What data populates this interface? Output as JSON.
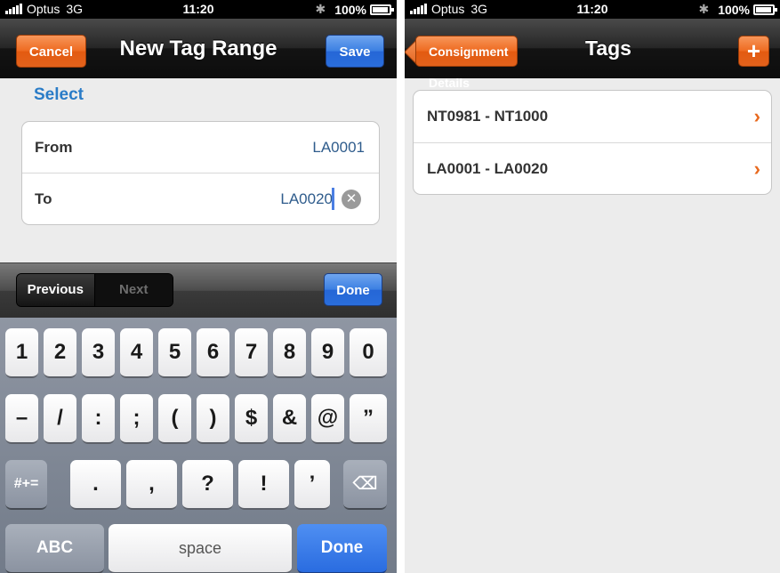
{
  "status": {
    "carrier": "Optus",
    "network": "3G",
    "time": "11:20",
    "battery": "100%"
  },
  "left": {
    "nav": {
      "cancel_label": "Cancel",
      "title": "New Tag Range",
      "save_label": "Save"
    },
    "section_title": "Select",
    "fields": {
      "from_label": "From",
      "from_value": "LA0001",
      "to_label": "To",
      "to_value": "LA0020"
    },
    "accessory": {
      "previous_label": "Previous",
      "next_label": "Next",
      "done_label": "Done"
    },
    "keyboard": {
      "row1": [
        "1",
        "2",
        "3",
        "4",
        "5",
        "6",
        "7",
        "8",
        "9",
        "0"
      ],
      "row2": [
        "–",
        "/",
        ":",
        ";",
        "(",
        ")",
        "$",
        "&",
        "@",
        "”"
      ],
      "row3": [
        "#+=",
        ".",
        ",",
        "?",
        "!",
        "’"
      ],
      "abc_label": "ABC",
      "space_label": "space",
      "done_label": "Done"
    }
  },
  "right": {
    "nav": {
      "back_label": "Consignment Details",
      "title": "Tags",
      "add_label": "+"
    },
    "tags": [
      "NT0981 - NT1000",
      "LA0001 - LA0020"
    ]
  },
  "colors": {
    "orange": "#ee6a20",
    "blue": "#2a6edc",
    "link_blue": "#2a7cc7"
  }
}
